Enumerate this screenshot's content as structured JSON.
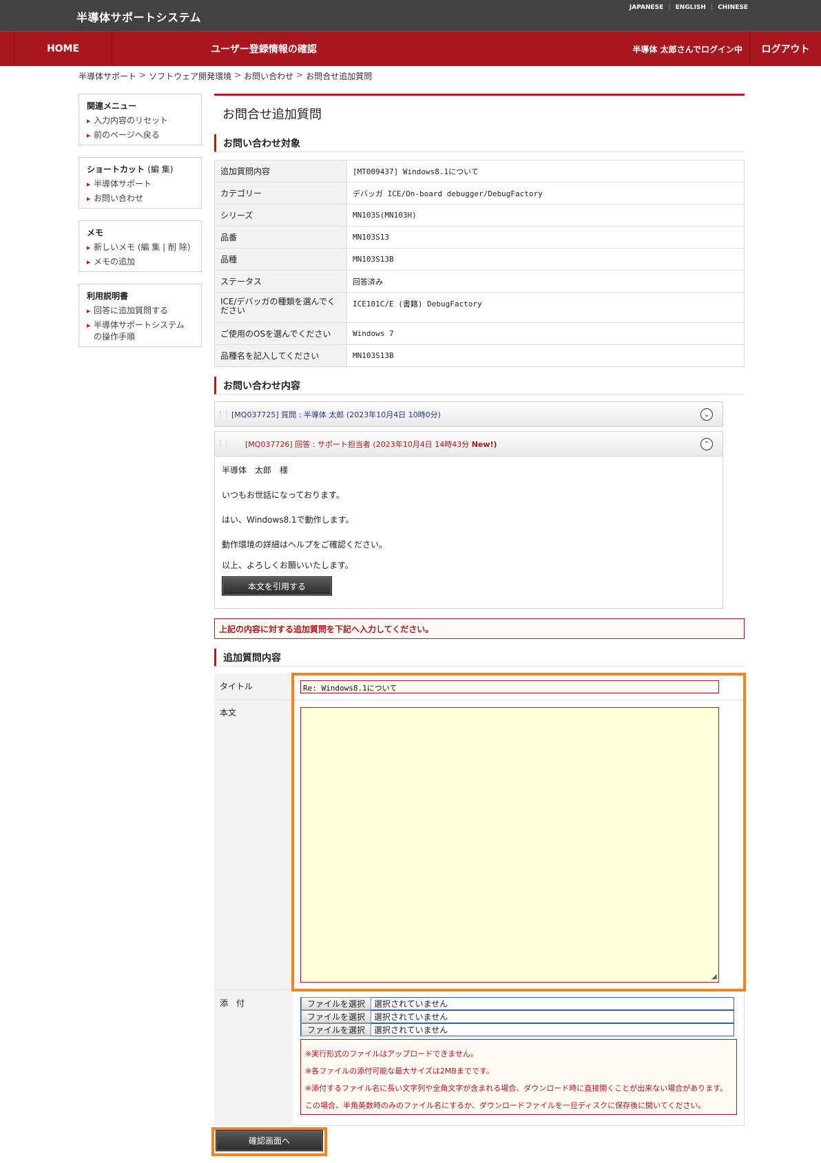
{
  "header": {
    "brand": "半導体サポートシステム",
    "languages": [
      "JAPANESE",
      "ENGLISH",
      "CHINESE"
    ]
  },
  "nav": {
    "home": "HOME",
    "title": "ユーザー登録情報の確認",
    "user": "半導体 太郎さんでログイン中",
    "logout": "ログアウト"
  },
  "breadcrumb": [
    "半導体サポート",
    "ソフトウェア開発環境",
    "お問い合わせ",
    "お問合せ追加質問"
  ],
  "sidebar": {
    "related": {
      "title": "関連メニュー",
      "items": [
        "入力内容のリセット",
        "前のページへ戻る"
      ]
    },
    "shortcut": {
      "title": "ショートカット",
      "edit": "(編 集)",
      "items": [
        "半導体サポート",
        "お問い合わせ"
      ]
    },
    "memo": {
      "title": "メモ",
      "items": [
        "新しいメモ (編 集 | 削 除)",
        "メモの追加"
      ]
    },
    "manual": {
      "title": "利用説明書",
      "items": [
        "回答に追加質問する",
        "半導体サポートシステムの操作手順"
      ]
    }
  },
  "page_title": "お問合せ追加質問",
  "target_section": {
    "title": "お問い合わせ対象",
    "rows": [
      {
        "key": "追加質問内容",
        "value": "[MT009437] Windows8.1について"
      },
      {
        "key": "カテゴリー",
        "value": "デバッガ ICE/On-board debugger/DebugFactory"
      },
      {
        "key": "シリーズ",
        "value": "MN103S(MN103H)"
      },
      {
        "key": "品番",
        "value": "MN103S13"
      },
      {
        "key": "品種",
        "value": "MN103S13B"
      },
      {
        "key": "ステータス",
        "value": "回答済み"
      },
      {
        "key": "ICE/デバッガの種類を選んでください",
        "value": "ICE101C/E (書籍) DebugFactory"
      },
      {
        "key": "ご使用のOSを選んでください",
        "value": "Windows 7"
      },
      {
        "key": "品種名を記入してください",
        "value": "MN103S13B"
      }
    ]
  },
  "content_section": {
    "title": "お問い合わせ内容",
    "question": "[MQ037725] 質問 : 半導体 太郎 (2023年10月4日 10時0分)",
    "answer_header": "[MQ037726] 回答 : サポート担当者 (2023年10月4日 14時43分 ",
    "answer_new": "New!)",
    "answer_lines": [
      "半導体　太郎　様",
      "いつもお世話になっております。",
      "はい、Windows8.1で動作します。",
      "動作環境の詳細はヘルプをご確認ください。",
      "以上、よろしくお願いいたします。"
    ],
    "quote_button": "本文を引用する"
  },
  "notice": "上記の内容に対する追加質問を下記へ入力してください。",
  "form_section": {
    "title": "追加質問内容",
    "title_label": "タイトル",
    "title_value": "Re: Windows8.1について",
    "body_label": "本文",
    "body_value": "",
    "attach_label": "添　付",
    "file_button": "ファイルを選択",
    "file_status": "選択されていません",
    "warnings": [
      "※実行形式のファイルはアップロードできません。",
      "※各ファイルの添付可能な最大サイズは2MBまでです。",
      "※添付するファイル名に長い文字列や全角文字が含まれる場合、ダウンロード時に直接開くことが出来ない場合があります。",
      "この場合、半角英数時のみのファイル名にするか、ダウンロードファイルを一旦ディスクに保存後に開いてください。"
    ]
  },
  "confirm_button": "確認画面へ",
  "colors": {
    "nav_red": "#a8161f",
    "top_gray": "#424242",
    "highlight_orange": "#f5821f",
    "body_yellow": "#fffed8"
  }
}
